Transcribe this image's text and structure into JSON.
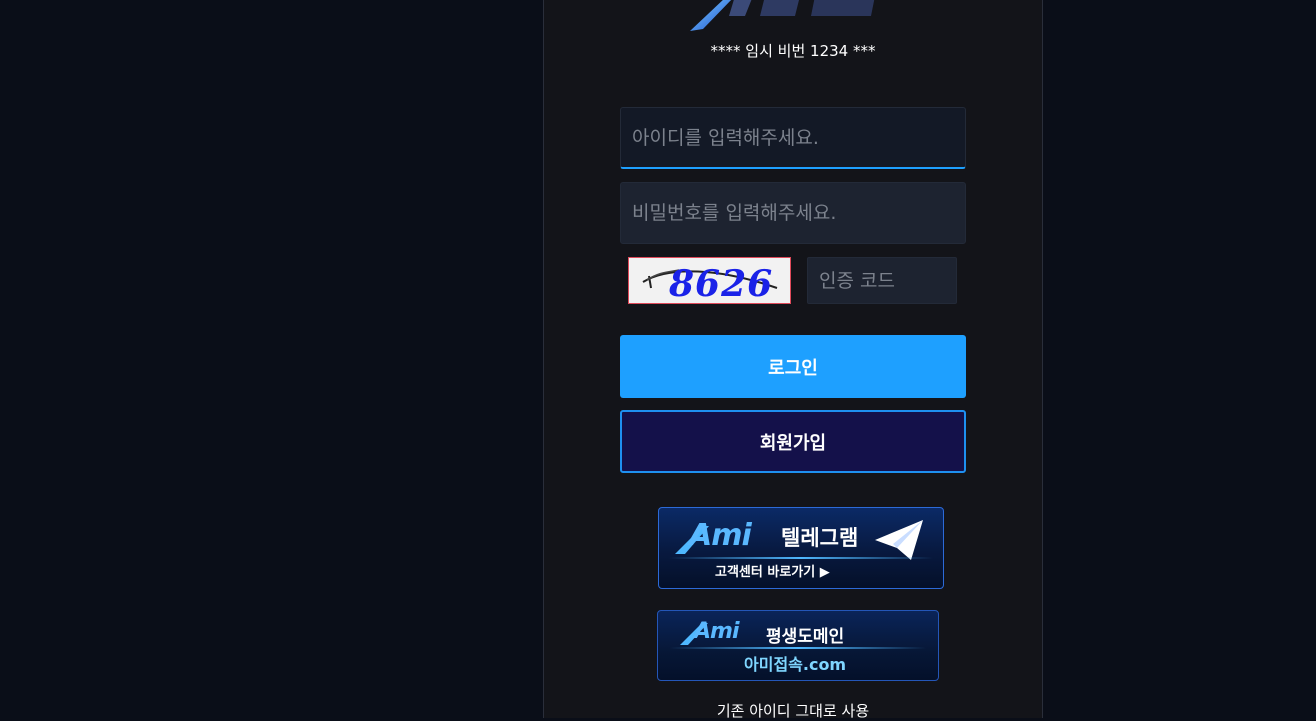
{
  "notice": "**** 임시 비번 1234 ***",
  "login_form": {
    "id_placeholder": "아이디를 입력해주세요.",
    "password_placeholder": "비밀번호를 입력해주세요.",
    "captcha_value": "8626",
    "code_placeholder": "인증 코드",
    "login_label": "로그인",
    "signup_label": "회원가입"
  },
  "banners": {
    "telegram": {
      "brand": "Ami",
      "title": "텔레그램",
      "subtitle": "고객센터 바로가기 ▶",
      "icon": "paper-plane-icon"
    },
    "domain": {
      "brand": "Ami",
      "title": "평생도메인",
      "subtitle": "아미접속.com"
    }
  },
  "footer_text": "기존 아이디 그대로 사용",
  "colors": {
    "accent": "#1ea0ff",
    "panel": "#131419",
    "background": "#0a0e18",
    "signup_bg": "#14114a"
  }
}
